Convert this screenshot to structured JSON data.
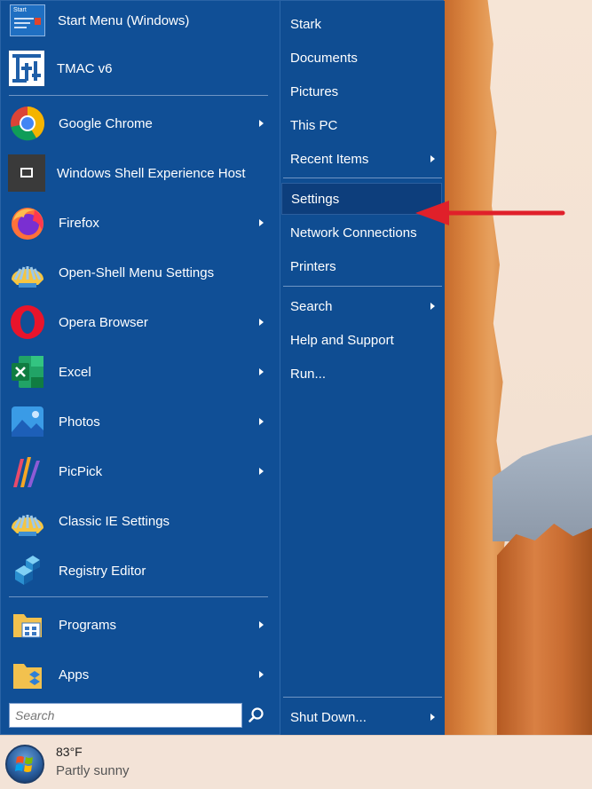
{
  "left_menu": {
    "items": [
      {
        "label": "Start Menu (Windows)",
        "icon": "start-menu-windows-icon",
        "arrow": false
      },
      {
        "label": "TMAC v6",
        "icon": "tmac-icon",
        "arrow": false
      },
      {
        "label": "Google Chrome",
        "icon": "chrome-icon",
        "arrow": true
      },
      {
        "label": "Windows Shell Experience Host",
        "icon": "shell-host-icon",
        "arrow": false
      },
      {
        "label": "Firefox",
        "icon": "firefox-icon",
        "arrow": true
      },
      {
        "label": "Open-Shell Menu Settings",
        "icon": "open-shell-icon",
        "arrow": false
      },
      {
        "label": "Opera Browser",
        "icon": "opera-icon",
        "arrow": true
      },
      {
        "label": "Excel",
        "icon": "excel-icon",
        "arrow": true
      },
      {
        "label": "Photos",
        "icon": "photos-icon",
        "arrow": true
      },
      {
        "label": "PicPick",
        "icon": "picpick-icon",
        "arrow": true
      },
      {
        "label": "Classic IE Settings",
        "icon": "classic-ie-icon",
        "arrow": false
      },
      {
        "label": "Registry Editor",
        "icon": "registry-editor-icon",
        "arrow": false
      },
      {
        "label": "Programs",
        "icon": "programs-icon",
        "arrow": true
      },
      {
        "label": "Apps",
        "icon": "apps-icon",
        "arrow": true
      }
    ],
    "start_tile_text": "Start"
  },
  "right_menu": {
    "items": [
      {
        "label": "Stark",
        "arrow": false
      },
      {
        "label": "Documents",
        "arrow": false
      },
      {
        "label": "Pictures",
        "arrow": false
      },
      {
        "label": "This PC",
        "arrow": false
      },
      {
        "label": "Recent Items",
        "arrow": true
      },
      {
        "label": "Settings",
        "arrow": false,
        "highlighted": true
      },
      {
        "label": "Network Connections",
        "arrow": false
      },
      {
        "label": "Printers",
        "arrow": false
      },
      {
        "label": "Search",
        "arrow": true
      },
      {
        "label": "Help and Support",
        "arrow": false
      },
      {
        "label": "Run...",
        "arrow": false
      },
      {
        "label": "Shut Down...",
        "arrow": true
      }
    ]
  },
  "search": {
    "placeholder": "Search"
  },
  "taskbar": {
    "temperature": "83°F",
    "condition": "Partly sunny"
  },
  "colors": {
    "menu_bg": "#104f96",
    "highlight": "#0d3e7c",
    "annotation_arrow": "#e0202a"
  }
}
